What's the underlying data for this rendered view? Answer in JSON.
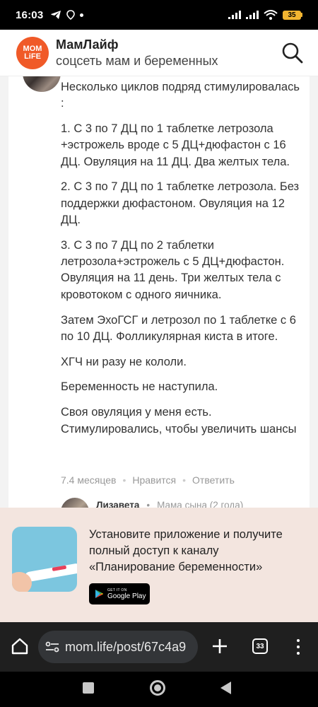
{
  "status_bar": {
    "time": "16:03",
    "battery": "35"
  },
  "app_header": {
    "logo_line1": "MOM",
    "logo_line2": "LiFE",
    "title": "МамЛайф",
    "subtitle": "соцсеть мам и беременных",
    "search_icon": "search-icon"
  },
  "comment": {
    "paragraphs": [
      "Несколько циклов подряд стимулировалась :",
      "1. С 3 по 7 ДЦ по 1 таблетке летрозола +эстрожель вроде с 5 ДЦ+дюфастон с 16 ДЦ. Овуляция на 11 ДЦ. Два желтых тела.",
      "2. С 3 по 7 ДЦ по 1 таблетке летрозола. Без поддержки дюфастоном. Овуляция на 12 ДЦ.",
      "3. С 3 по 7 ДЦ по 2 таблетки летрозола+эстрожель с 5 ДЦ+дюфастон. Овуляция на 11 день. Три желтых тела с кровотоком с одного яичника.",
      "Затем ЭхоГСГ и летрозол по 1 таблетке с 6 по 10 ДЦ. Фолликулярная киста в итоге.",
      "ХГЧ ни разу не кололи.",
      "Беременность не наступила.",
      "Своя овуляция у меня есть. Стимулировались, чтобы увеличить шансы"
    ],
    "time_ago": "7.4 месяцев",
    "like_label": "Нравится",
    "reply_label": "Ответить"
  },
  "reply_preview": {
    "author": "Лизавета",
    "status": "Мама сына (2 года)"
  },
  "install_banner": {
    "text": "Установите приложение и получите полный доступ к каналу «Планирование беременности»",
    "store_small": "GET IT ON",
    "store_name": "Google Play"
  },
  "browser": {
    "url": "mom.life/post/67c4a9",
    "tab_count": "33"
  },
  "colors": {
    "brand": "#f05a28",
    "banner_bg": "#f3e5df",
    "browser_bg": "#1f1f1f"
  }
}
